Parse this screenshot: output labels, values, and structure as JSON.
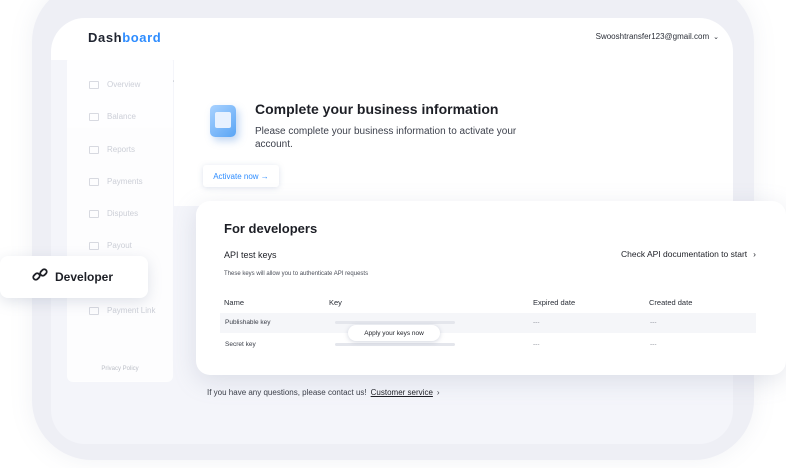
{
  "header": {
    "logo_part1": "Dash",
    "logo_part2": "board",
    "account_email": "Swooshtransfer123@gmail.com",
    "account_chevron": "⌄"
  },
  "sidebar": {
    "items": [
      {
        "label": "Overview",
        "icon": "overview-icon"
      },
      {
        "label": "Balance",
        "icon": "balance-icon"
      },
      {
        "label": "Reports",
        "icon": "reports-icon"
      },
      {
        "label": "Payments",
        "icon": "payments-icon"
      },
      {
        "label": "Disputes",
        "icon": "disputes-icon"
      },
      {
        "label": "Payout",
        "icon": "payout-icon"
      },
      {
        "label": "Payment Link",
        "icon": "payment-link-icon"
      }
    ],
    "privacy": "Privacy Policy",
    "collapse_glyph": "‹"
  },
  "floating_item": {
    "label": "Developer",
    "icon": "link-icon",
    "glyph": "🔗"
  },
  "business": {
    "title": "Complete your business information",
    "description": "Please complete your business information to activate your account.",
    "activate_label": "Activate now →"
  },
  "developers": {
    "title": "For developers",
    "api_label": "API test keys",
    "doc_link": "Check API documentation to start",
    "doc_chevron": "›",
    "note": "These keys will allow you to authenticate API requests",
    "columns": [
      "Name",
      "Key",
      "Expired date",
      "Created date"
    ],
    "rows": [
      {
        "name": "Publishable key",
        "expired": "---",
        "created": "---"
      },
      {
        "name": "Secret key",
        "expired": "---",
        "created": "---"
      }
    ],
    "apply_label": "Apply your keys now"
  },
  "footer": {
    "text": "If you have any questions, please contact us!",
    "link": "Customer service",
    "chevron": "›"
  },
  "colors": {
    "accent": "#2d8cff",
    "text": "#1d1f26",
    "background": "#f4f5fa"
  }
}
